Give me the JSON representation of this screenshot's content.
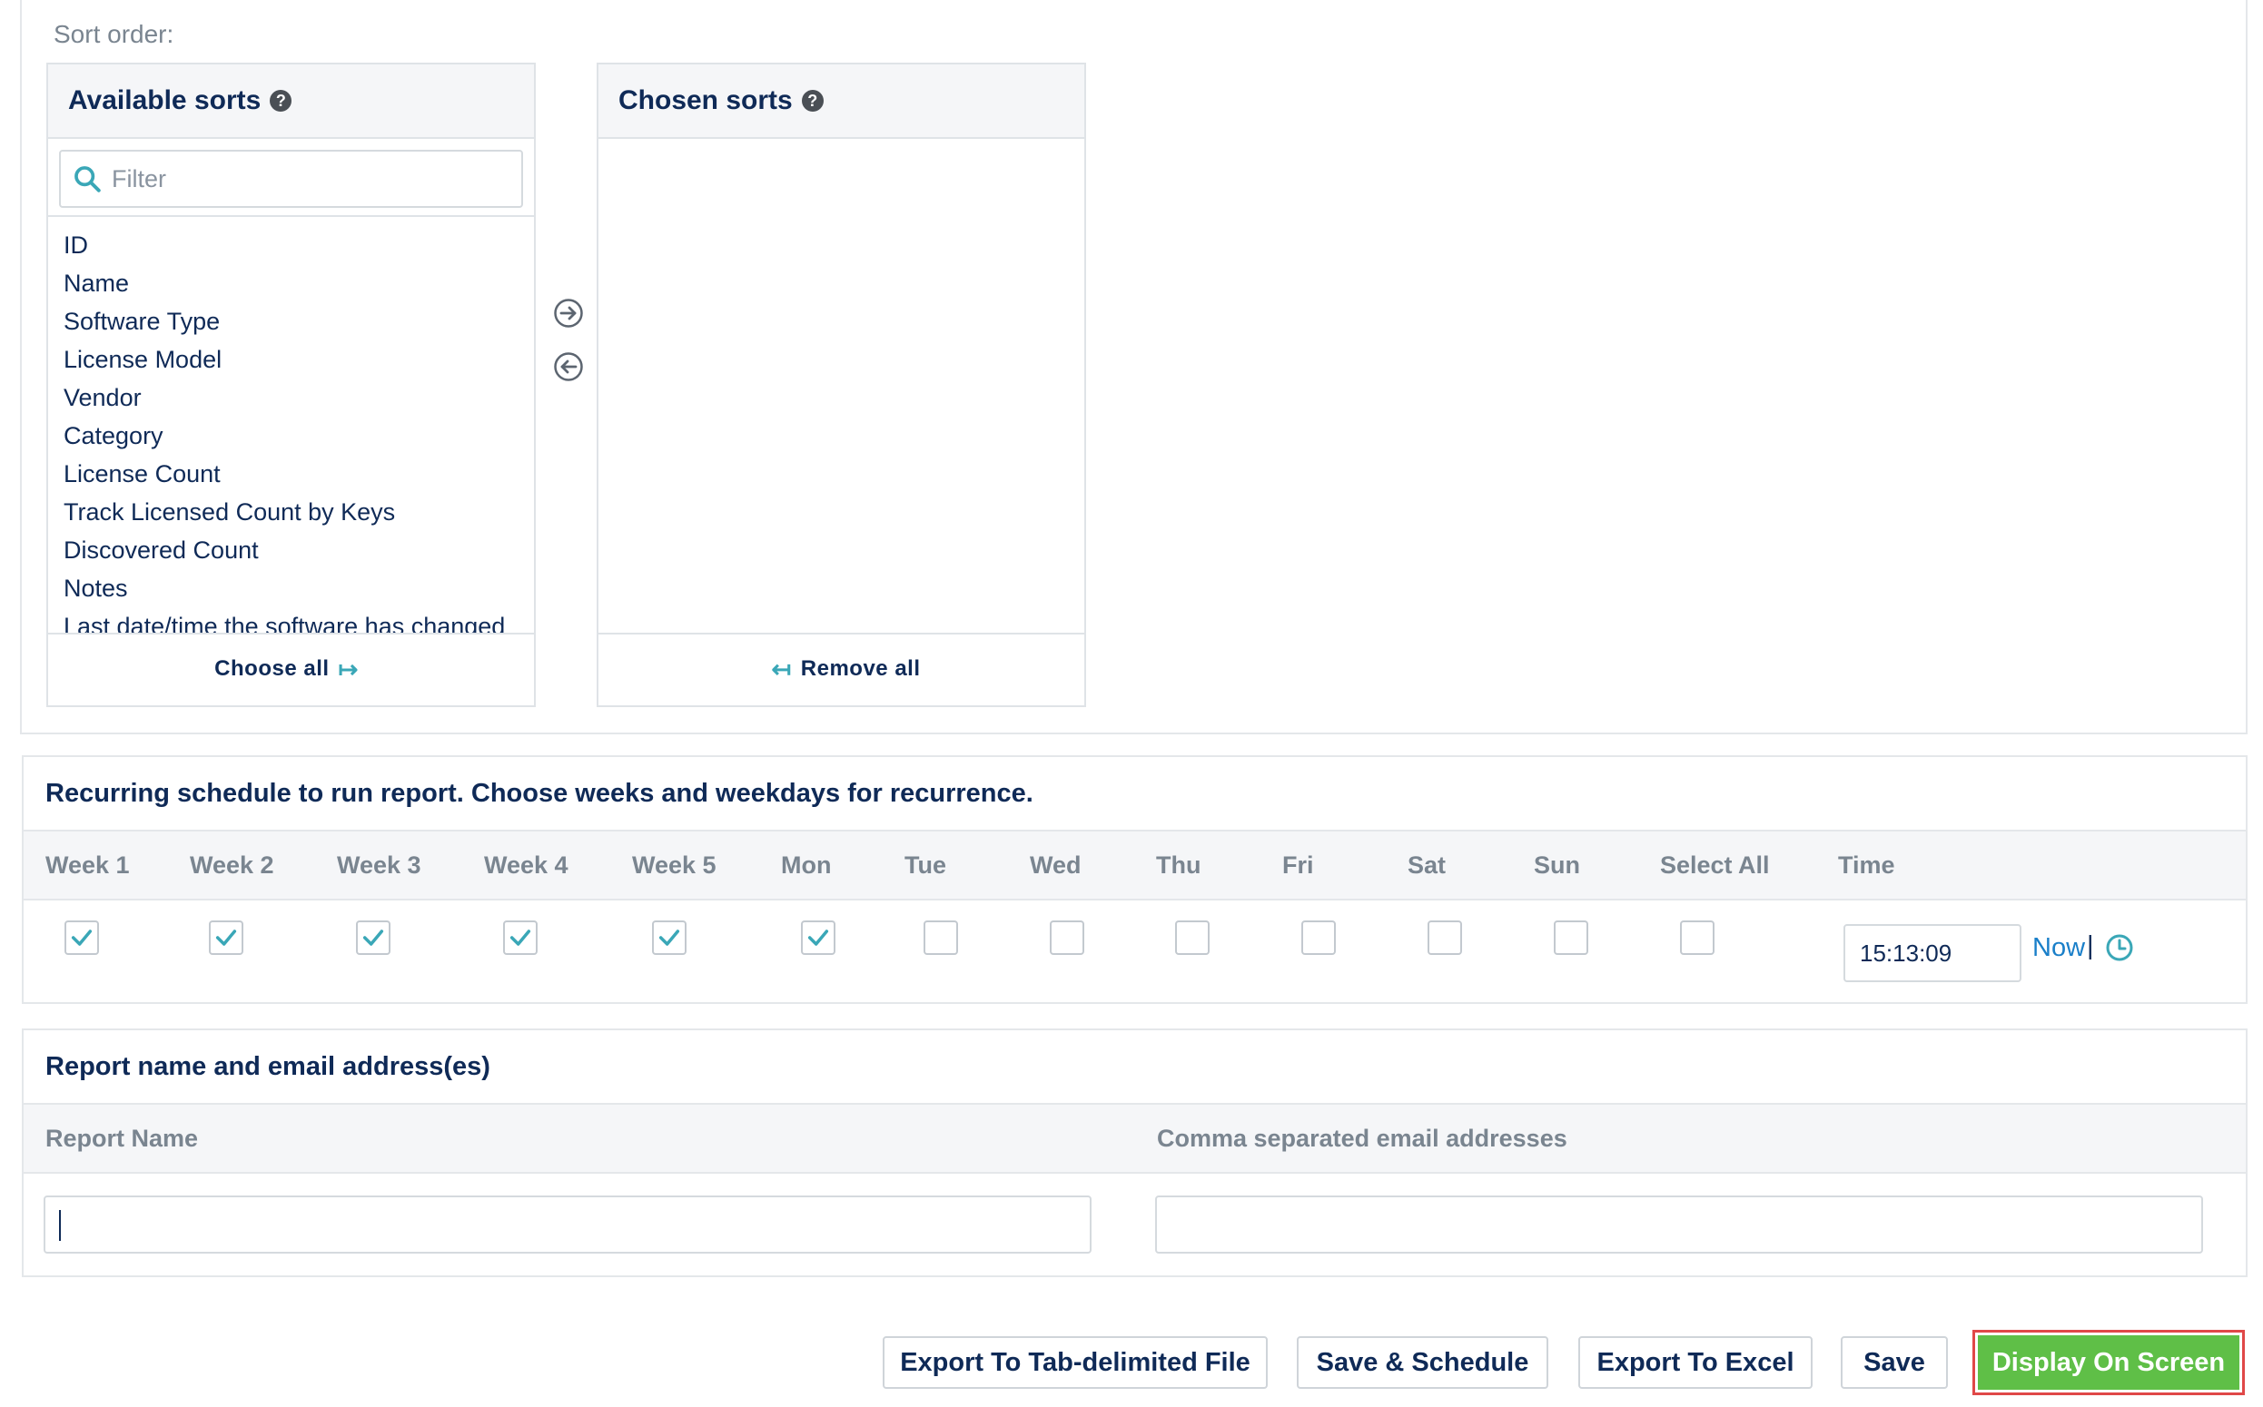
{
  "sort": {
    "label": "Sort order:",
    "available": {
      "title": "Available sorts",
      "filter_placeholder": "Filter",
      "items": [
        "ID",
        "Name",
        "Software Type",
        "License Model",
        "Vendor",
        "Category",
        "License Count",
        "Track Licensed Count by Keys",
        "Discovered Count",
        "Notes",
        "Last date/time the software has changed"
      ],
      "choose_all_label": "Choose all"
    },
    "chosen": {
      "title": "Chosen sorts",
      "remove_all_label": "Remove all"
    },
    "help_glyph": "?"
  },
  "schedule": {
    "title": "Recurring schedule to run report. Choose weeks and weekdays for recurrence.",
    "columns": [
      "Week 1",
      "Week 2",
      "Week 3",
      "Week 4",
      "Week 5",
      "Mon",
      "Tue",
      "Wed",
      "Thu",
      "Fri",
      "Sat",
      "Sun",
      "Select All",
      "Time"
    ],
    "checked": [
      true,
      true,
      true,
      true,
      true,
      true,
      false,
      false,
      false,
      false,
      false,
      false,
      false
    ],
    "time_value": "15:13:09",
    "now_label": "Now",
    "separator": "|"
  },
  "report": {
    "title": "Report name and email address(es)",
    "name_label": "Report Name",
    "email_label": "Comma separated email addresses",
    "name_value": "",
    "email_value": ""
  },
  "buttons": {
    "export_tab": "Export To Tab-delimited File",
    "save_schedule": "Save & Schedule",
    "export_excel": "Export To Excel",
    "save": "Save",
    "display": "Display On Screen"
  },
  "colors": {
    "accent": "#3aa7b7",
    "primary_button": "#5fbf47",
    "highlight_border": "#e04848",
    "link": "#1a7fc9",
    "text": "#0f2a57"
  }
}
